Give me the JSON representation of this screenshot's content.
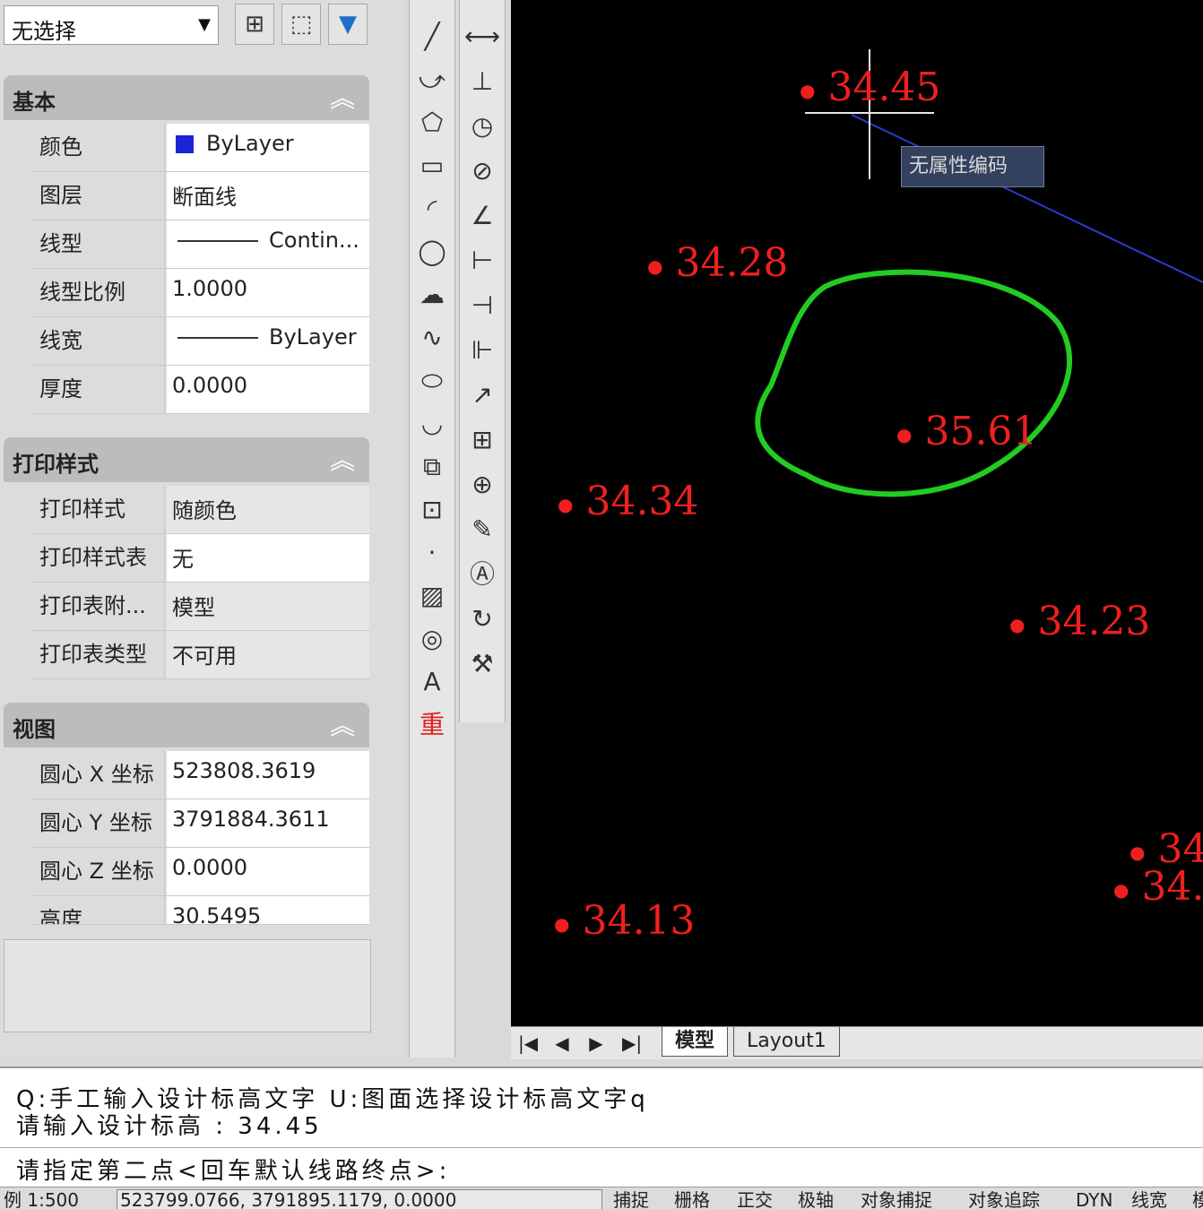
{
  "selector": {
    "value": "无选择"
  },
  "sections": {
    "basic": {
      "title": "基本",
      "rows": [
        {
          "label": "颜色",
          "value": "ByLayer"
        },
        {
          "label": "图层",
          "value": "断面线"
        },
        {
          "label": "线型",
          "value": "Contin..."
        },
        {
          "label": "线型比例",
          "value": "1.0000"
        },
        {
          "label": "线宽",
          "value": "ByLayer"
        },
        {
          "label": "厚度",
          "value": "0.0000"
        }
      ]
    },
    "print": {
      "title": "打印样式",
      "rows": [
        {
          "label": "打印样式",
          "value": "随颜色"
        },
        {
          "label": "打印样式表",
          "value": "无"
        },
        {
          "label": "打印表附...",
          "value": "模型"
        },
        {
          "label": "打印表类型",
          "value": "不可用"
        }
      ]
    },
    "view": {
      "title": "视图",
      "rows": [
        {
          "label": "圆心 X 坐标",
          "value": "523808.3619"
        },
        {
          "label": "圆心 Y 坐标",
          "value": "3791884.3611"
        },
        {
          "label": "圆心 Z 坐标",
          "value": "0.0000"
        },
        {
          "label": "高度",
          "value": "30.5495"
        }
      ]
    }
  },
  "colors": {
    "color_swatch": "#1a26d6",
    "elevation_text": "#f01f1f",
    "boundary": "#22cc22",
    "tooltip_bg": "#33405e"
  },
  "drawing": {
    "tooltip": "无属性编码",
    "points": [
      {
        "label": "34.45"
      },
      {
        "label": "34.28"
      },
      {
        "label": "35.61"
      },
      {
        "label": "34.34"
      },
      {
        "label": "34.23"
      },
      {
        "label": "34.13"
      },
      {
        "label": "34."
      },
      {
        "label": "34."
      }
    ]
  },
  "tabs": {
    "model": "模型",
    "layout1": "Layout1"
  },
  "toolbar1_icons": [
    "line-icon",
    "polyline-icon",
    "polygon-icon",
    "rectangle-icon",
    "arc-icon",
    "circle-icon",
    "cloud-icon",
    "spline-icon",
    "ellipse-icon",
    "ellipse-arc-icon",
    "insert-block-icon",
    "make-block-icon",
    "point-icon",
    "hatch-icon",
    "region-icon",
    "text-icon",
    "redo-icon"
  ],
  "toolbar2_icons": [
    "dim-linear-icon",
    "dim-ordinate-icon",
    "dim-radius-icon",
    "dim-diameter-icon",
    "dim-angular-icon",
    "quick-dim-icon",
    "dim-baseline-icon",
    "dim-continue-icon",
    "quick-leader-icon",
    "tolerance-icon",
    "center-mark-icon",
    "dim-edit-icon",
    "dim-text-edit-icon",
    "dim-update-icon",
    "dim-style-icon"
  ],
  "command": {
    "line1": "Q:手工输入设计标高文字 U:图面选择设计标高文字q",
    "line2": "请输入设计标高 : 34.45",
    "line3": "请指定第二点<回车默认线路终点>:"
  },
  "status": {
    "scale": "例  1:500",
    "coords": "523799.0766, 3791895.1179, 0.0000",
    "buttons": [
      "捕捉",
      "栅格",
      "正交",
      "极轴",
      "对象捕捉",
      "对象追踪",
      "DYN",
      "线宽",
      "模"
    ]
  }
}
